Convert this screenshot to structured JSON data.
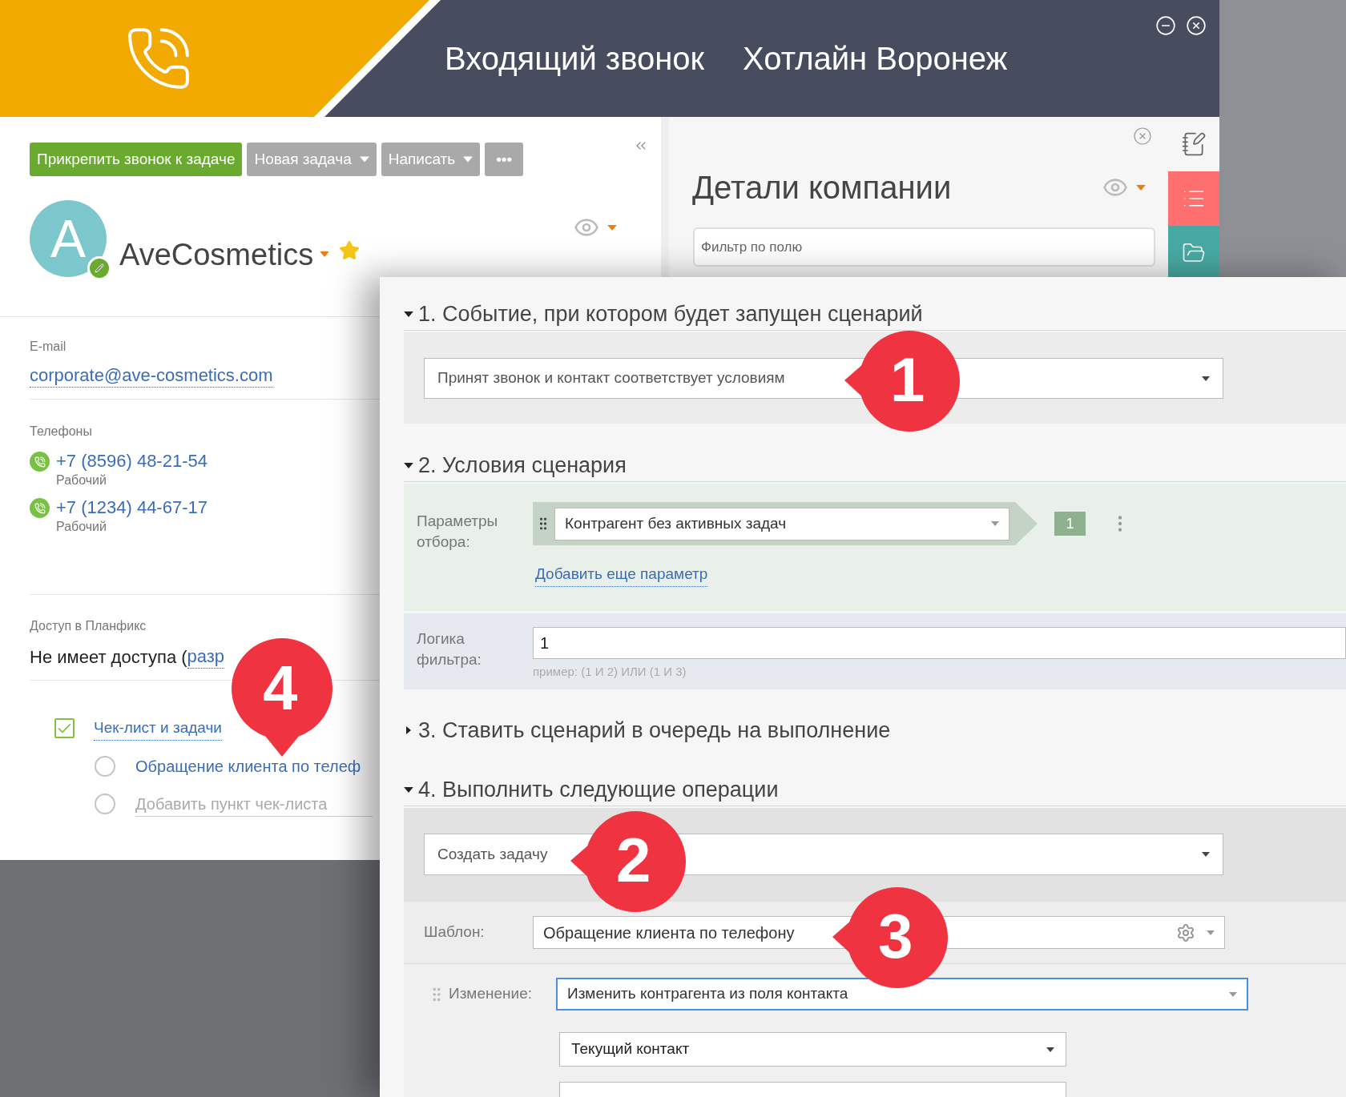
{
  "window": {
    "title": "Входящий звонок",
    "line": "Хотлайн Воронеж"
  },
  "toolbar": [
    {
      "label": "Прикрепить звонок к задаче",
      "kind": "primary"
    },
    {
      "label": "Новая задача",
      "kind": "dropdown"
    },
    {
      "label": "Написать",
      "kind": "dropdown"
    },
    {
      "label": "•••",
      "kind": "more"
    }
  ],
  "contact": {
    "avatar_letter": "A",
    "name": "AveCosmetics",
    "favorite": true,
    "email_label": "E-mail",
    "email": "corporate@ave-cosmetics.com",
    "phones_label": "Телефоны",
    "phones": [
      {
        "number": "+7 (8596) 48-21-54",
        "type": "Рабочий"
      },
      {
        "number": "+7 (1234) 44-67-17",
        "type": "Рабочий"
      }
    ],
    "access_label": "Доступ в Планфикс",
    "access_text": "Не имеет доступа (",
    "access_link": "разр"
  },
  "checklist": {
    "title": "Чек-лист и задачи",
    "checked": true,
    "callout": "4",
    "items": [
      {
        "label": "Обращение клиента по телеф",
        "done": false
      }
    ],
    "add_placeholder": "Добавить пункт чек-листа",
    "add_done": false
  },
  "details": {
    "title": "Детали компании",
    "filter_placeholder": "Фильтр по полю"
  },
  "scenario": {
    "sections": [
      {
        "kind": "event",
        "title": "1. Событие, при котором будет запущен сценарий",
        "expanded": true,
        "value": "Принят звонок и контакт соответствует условиям",
        "callout": "1"
      },
      {
        "kind": "conditions",
        "title": "2. Условия сценария",
        "expanded": true,
        "params_label": "Параметры отбора:",
        "param": "Контрагент без активных задач",
        "param_number": "1",
        "add_link": "Добавить еще параметр",
        "logic_label": "Логика фильтра:",
        "logic_value": "1",
        "logic_hint": "пример: (1 И 2) ИЛИ (1 И 3)"
      },
      {
        "kind": "queue",
        "title": "3. Ставить сценарий в очередь на выполнение",
        "expanded": false
      },
      {
        "kind": "operations",
        "title": "4. Выполнить следующие операции",
        "expanded": true,
        "value": "Создать задачу",
        "callout": "2",
        "template_label": "Шаблон:",
        "template": "Обращение клиента по телефону",
        "template_callout": "3",
        "change_label": "Изменение:",
        "change": "Изменить контрагента из поля контакта",
        "source": "Текущий контакт"
      }
    ]
  }
}
